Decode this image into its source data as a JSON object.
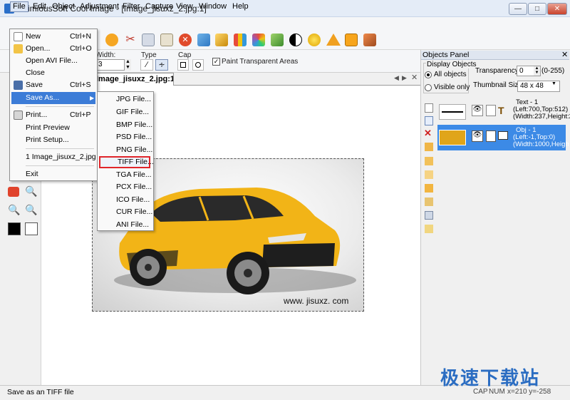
{
  "window": {
    "title": "EximiousSoft Cool Image - [Image_jisuxz_2.jpg:1]"
  },
  "menubar": [
    "File",
    "Edit",
    "Object",
    "Adjustment",
    "Filter",
    "Capture",
    "View",
    "Window",
    "Help"
  ],
  "options": {
    "width_label": "Width:",
    "type_label": "Type",
    "cap_label": "Cap",
    "paint_transparent_label": "Paint Transparent Areas",
    "paint_transparent_checked": true
  },
  "document": {
    "tab_title": "Image_jisuxz_2.jpg:1",
    "watermark": "www. jisuxz. com"
  },
  "file_menu": {
    "items": [
      {
        "label": "New",
        "shortcut": "Ctrl+N",
        "icon": "new-file-icon"
      },
      {
        "label": "Open...",
        "shortcut": "Ctrl+O",
        "icon": "open-folder-icon"
      },
      {
        "label": "Open AVI File...",
        "shortcut": ""
      },
      {
        "label": "Close",
        "shortcut": ""
      },
      {
        "label": "Save",
        "shortcut": "Ctrl+S",
        "icon": "save-icon"
      },
      {
        "label": "Save As...",
        "shortcut": "",
        "highlighted": true,
        "submenu": true
      },
      {
        "label": "Print...",
        "shortcut": "Ctrl+P",
        "icon": "printer-icon"
      },
      {
        "label": "Print Preview",
        "shortcut": ""
      },
      {
        "label": "Print Setup...",
        "shortcut": ""
      },
      {
        "label": "1 Image_jisuxz_2.jpg",
        "shortcut": ""
      },
      {
        "label": "Exit",
        "shortcut": ""
      }
    ]
  },
  "save_as_menu": {
    "items": [
      "JPG File...",
      "GIF File...",
      "BMP File...",
      "PSD File...",
      "PNG File...",
      "TIFF File...",
      "TGA File...",
      "PCX File...",
      "ICO File...",
      "CUR File...",
      "ANI File..."
    ],
    "selected_index": 5
  },
  "objects_panel": {
    "title": "Objects Panel",
    "display_objects_label": "Display Objects",
    "all_objects_label": "All objects",
    "visible_only_label": "Visible only",
    "display_mode": "all",
    "transparency_label": "Transparency:",
    "transparency_value": "0",
    "transparency_range": "(0-255)",
    "thumbnail_size_label": "Thumbnail Size:",
    "thumbnail_size_value": "48 x 48",
    "objects": [
      {
        "name": "Text - 1",
        "pos": "(Left:700,Top:512)",
        "size": "(Width:237,Height:2",
        "selected": false
      },
      {
        "name": "Obj - 1",
        "pos": "(Left:-1,Top:0)",
        "size": "(Width:1000,Heigh",
        "selected": true
      }
    ]
  },
  "statusbar": {
    "message": "Save as an  TIFF file",
    "caps": "CAP",
    "num": "NUM",
    "coords": "x=210 y=-258"
  },
  "brand": {
    "text": "极速下载站"
  },
  "colors": {
    "highlight": "#3c7cd7",
    "selection_border": "#e0262b",
    "car_yellow": "#f2b417"
  }
}
